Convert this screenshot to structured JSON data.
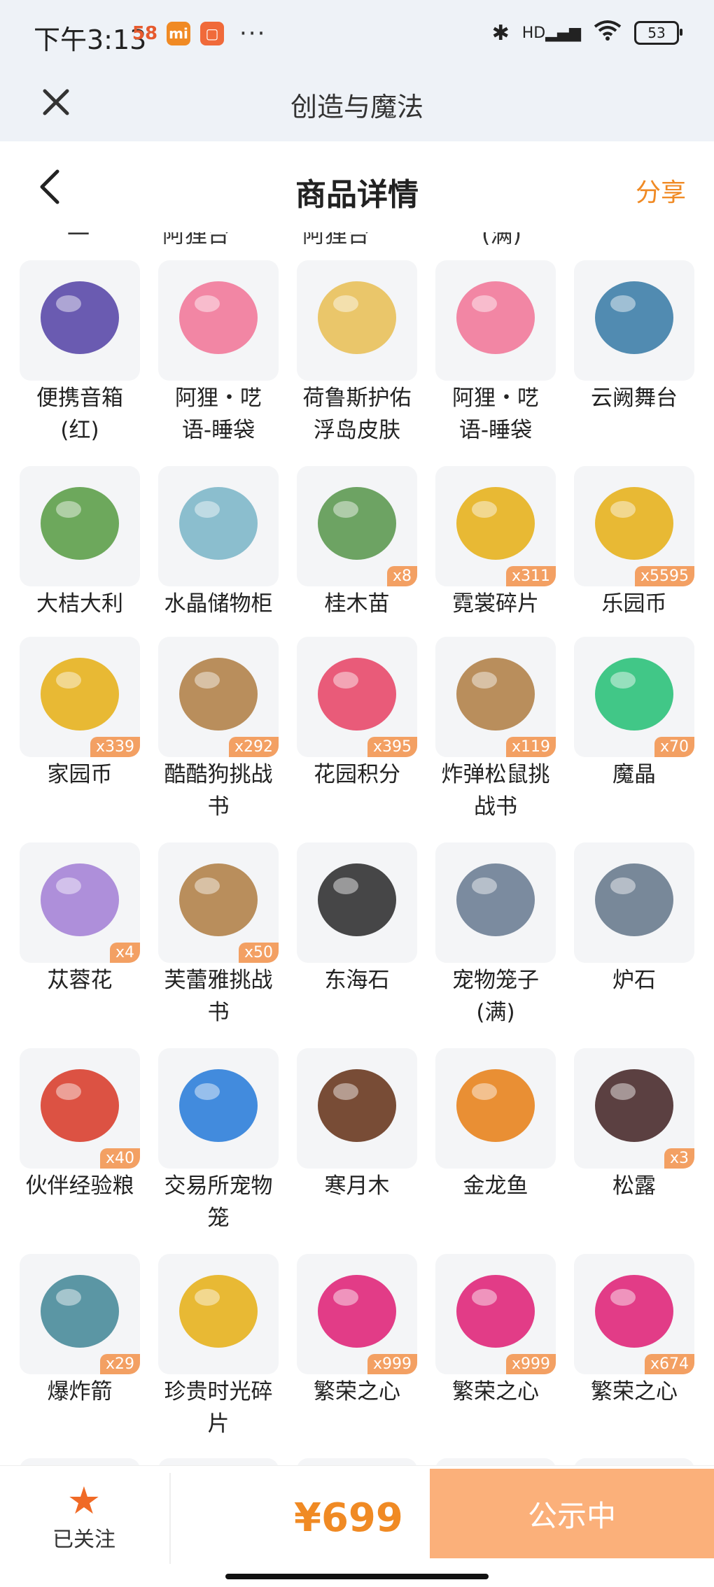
{
  "status_bar": {
    "time": "下午3:13",
    "battery": "53",
    "network": "HD",
    "more": "···"
  },
  "title_bar": {
    "title": "创造与魔法"
  },
  "page_header": {
    "title": "商品详情",
    "share": "分享"
  },
  "items": [
    {
      "name": "便携音箱(红)",
      "line1": "便携音箱",
      "line2": "(红)",
      "count": ""
    },
    {
      "name": "阿狸・呓语-睡袋",
      "line1": "阿狸・呓",
      "line2": "语-睡袋",
      "count": ""
    },
    {
      "name": "荷鲁斯护佑浮岛皮肤",
      "line1": "荷鲁斯护佑",
      "line2": "浮岛皮肤",
      "count": ""
    },
    {
      "name": "阿狸・呓语-睡袋",
      "line1": "阿狸・呓",
      "line2": "语-睡袋",
      "count": ""
    },
    {
      "name": "云阙舞台",
      "line1": "云阙舞台",
      "line2": "",
      "count": ""
    },
    {
      "name": "大桔大利",
      "line1": "大桔大利",
      "line2": "",
      "count": ""
    },
    {
      "name": "水晶储物柜",
      "line1": "水晶储物柜",
      "line2": "",
      "count": ""
    },
    {
      "name": "桂木苗",
      "line1": "桂木苗",
      "line2": "",
      "count": "x8"
    },
    {
      "name": "霓裳碎片",
      "line1": "霓裳碎片",
      "line2": "",
      "count": "x311"
    },
    {
      "name": "乐园币",
      "line1": "乐园币",
      "line2": "",
      "count": "x5595"
    },
    {
      "name": "家园币",
      "line1": "家园币",
      "line2": "",
      "count": "x339"
    },
    {
      "name": "酷酷狗挑战书",
      "line1": "酷酷狗挑战",
      "line2": "书",
      "count": "x292"
    },
    {
      "name": "花园积分",
      "line1": "花园积分",
      "line2": "",
      "count": "x395"
    },
    {
      "name": "炸弹松鼠挑战书",
      "line1": "炸弹松鼠挑",
      "line2": "战书",
      "count": "x119"
    },
    {
      "name": "魔晶",
      "line1": "魔晶",
      "line2": "",
      "count": "x70"
    },
    {
      "name": "苁蓉花",
      "line1": "苁蓉花",
      "line2": "",
      "count": "x4"
    },
    {
      "name": "芙蕾雅挑战书",
      "line1": "芙蕾雅挑战",
      "line2": "书",
      "count": "x50"
    },
    {
      "name": "东海石",
      "line1": "东海石",
      "line2": "",
      "count": ""
    },
    {
      "name": "宠物笼子(满)",
      "line1": "宠物笼子",
      "line2": "(满)",
      "count": ""
    },
    {
      "name": "炉石",
      "line1": "炉石",
      "line2": "",
      "count": ""
    },
    {
      "name": "伙伴经验粮",
      "line1": "伙伴经验粮",
      "line2": "",
      "count": "x40"
    },
    {
      "name": "交易所宠物笼",
      "line1": "交易所宠物",
      "line2": "笼",
      "count": ""
    },
    {
      "name": "寒月木",
      "line1": "寒月木",
      "line2": "",
      "count": ""
    },
    {
      "name": "金龙鱼",
      "line1": "金龙鱼",
      "line2": "",
      "count": ""
    },
    {
      "name": "松露",
      "line1": "松露",
      "line2": "",
      "count": "x3"
    },
    {
      "name": "爆炸箭",
      "line1": "爆炸箭",
      "line2": "",
      "count": "x29"
    },
    {
      "name": "珍贵时光碎片",
      "line1": "珍贵时光碎",
      "line2": "片",
      "count": ""
    },
    {
      "name": "繁荣之心",
      "line1": "繁荣之心",
      "line2": "",
      "count": "x999"
    },
    {
      "name": "繁荣之心",
      "line1": "繁荣之心",
      "line2": "",
      "count": "x999"
    },
    {
      "name": "繁荣之心",
      "line1": "繁荣之心",
      "line2": "",
      "count": "x674"
    }
  ],
  "bottom_bar": {
    "follow_label": "已关注",
    "price": "¥699",
    "button_label": "公示中"
  },
  "colors": {
    "accent": "#f08a24",
    "button": "#fbb07a",
    "badge": "#f3a063",
    "title_bg": "#eef2f7"
  }
}
